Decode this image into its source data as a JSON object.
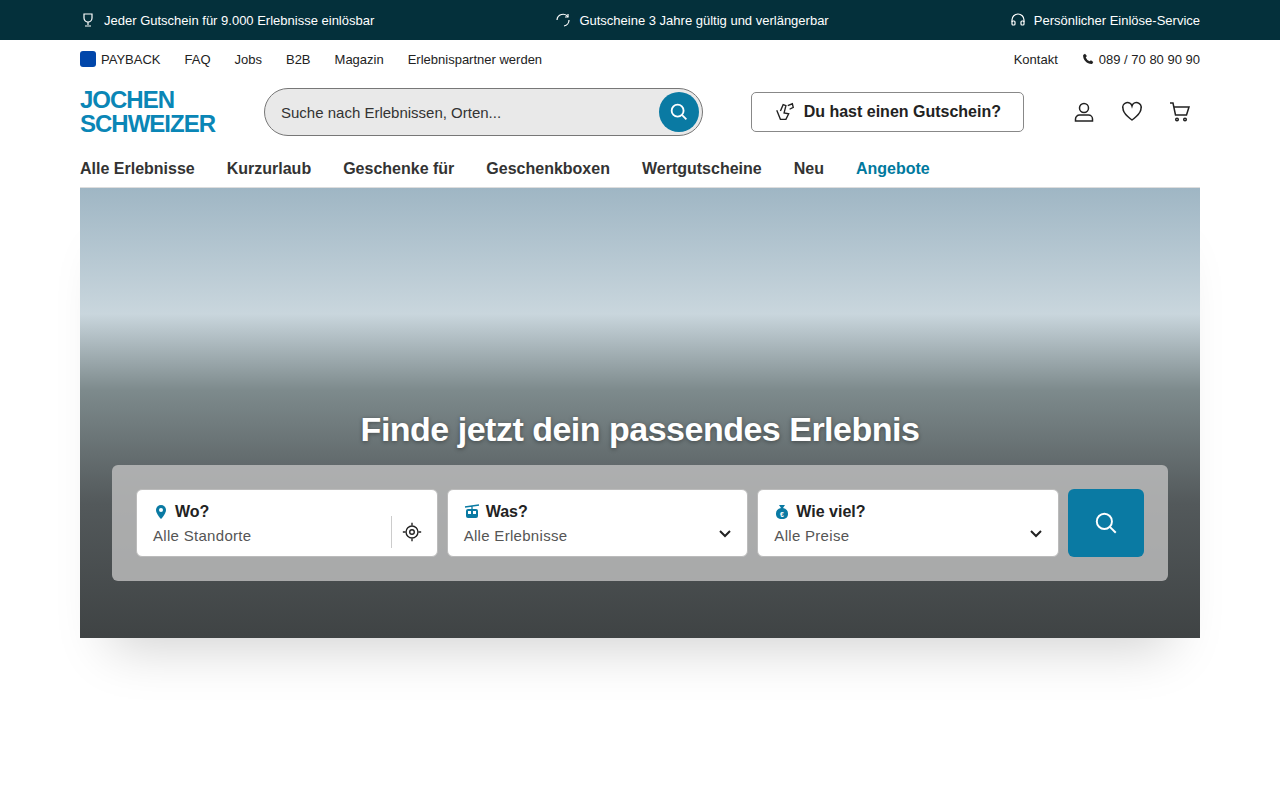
{
  "topbar": [
    {
      "text": "Jeder Gutschein für 9.000 Erlebnisse einlösbar",
      "kind": "trophy"
    },
    {
      "text": "Gutscheine 3 Jahre gültig und verlängerbar",
      "kind": "refresh"
    },
    {
      "text": "Persönlicher Einlöse-Service",
      "kind": "headset"
    }
  ],
  "utility": {
    "left": [
      {
        "label": "PAYBACK",
        "kind": "payback"
      },
      {
        "label": "FAQ",
        "kind": "link"
      },
      {
        "label": "Jobs",
        "kind": "link"
      },
      {
        "label": "B2B",
        "kind": "link"
      },
      {
        "label": "Magazin",
        "kind": "link"
      },
      {
        "label": "Erlebnispartner werden",
        "kind": "link"
      }
    ],
    "right": [
      {
        "label": "Kontakt",
        "kind": "link"
      },
      {
        "label": "089 / 70 80 90 90",
        "kind": "phone"
      }
    ]
  },
  "logo": [
    "JOCHEN",
    "SCHWEIZER"
  ],
  "search": {
    "placeholder": "Suche nach Erlebnissen, Orten..."
  },
  "voucher_button": "Du hast einen Gutschein?",
  "nav": [
    {
      "label": "Alle Erlebnisse",
      "selected": false
    },
    {
      "label": "Kurzurlaub",
      "selected": false
    },
    {
      "label": "Geschenke für",
      "selected": false
    },
    {
      "label": "Geschenkboxen",
      "selected": false
    },
    {
      "label": "Wertgutscheine",
      "selected": false
    },
    {
      "label": "Neu",
      "selected": false
    },
    {
      "label": "Angebote",
      "selected": true
    }
  ],
  "hero": {
    "title": "Finde jetzt dein passendes Erlebnis",
    "filters": [
      {
        "label": "Wo?",
        "value": "Alle Standorte",
        "kind": "location"
      },
      {
        "label": "Was?",
        "value": "Alle Erlebnisse",
        "kind": "category"
      },
      {
        "label": "Wie viel?",
        "value": "Alle Preise",
        "kind": "price"
      }
    ]
  }
}
